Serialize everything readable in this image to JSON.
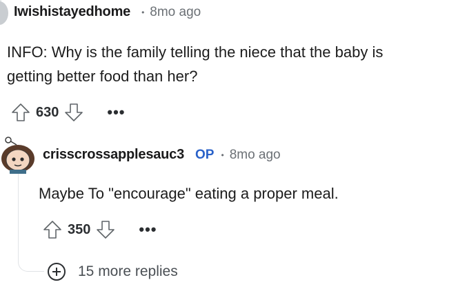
{
  "comment": {
    "username": "Iwishistayedhome",
    "separator": "•",
    "age": "8mo ago",
    "body_line1": "INFO: Why is the family telling the niece that the baby is",
    "body_line2": "getting better food than her?",
    "score": "630",
    "more": "•••"
  },
  "reply": {
    "username": "crisscrossapplesauc3",
    "op_badge": "OP",
    "separator": "•",
    "age": "8mo ago",
    "body": "Maybe To \"encourage\" eating a proper meal.",
    "score": "350",
    "more": "•••"
  },
  "more_replies": {
    "icon": "plus-circle-icon",
    "label": "15 more replies"
  },
  "colors": {
    "username": "#1a1a1b",
    "meta": "#6b7075",
    "op": "#2a62c9",
    "thread_line": "#e0e3e6"
  }
}
